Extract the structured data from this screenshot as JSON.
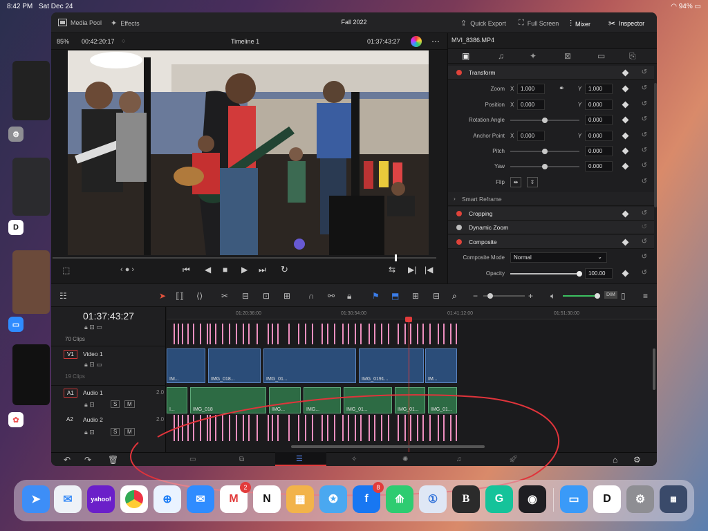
{
  "status": {
    "time": "8:42 PM",
    "date": "Sat Dec 24",
    "battery": "94%"
  },
  "topbar": {
    "media_pool": "Media Pool",
    "effects": "Effects",
    "title": "Fall 2022",
    "quick_export": "Quick Export",
    "full_screen": "Full Screen",
    "mixer": "Mixer",
    "inspector": "Inspector"
  },
  "viewer": {
    "zoom": "85%",
    "duration": "00:42:20:17",
    "timeline_name": "Timeline 1",
    "timecode": "01:37:43:27"
  },
  "inspector": {
    "clip_name": "MVI_8386.MP4",
    "sections": {
      "transform": "Transform",
      "smart_reframe": "Smart Reframe",
      "cropping": "Cropping",
      "dynamic_zoom": "Dynamic Zoom",
      "composite": "Composite"
    },
    "zoom": {
      "label": "Zoom",
      "x": "1.000",
      "y": "1.000"
    },
    "position": {
      "label": "Position",
      "x": "0.000",
      "y": "0.000"
    },
    "rotation": {
      "label": "Rotation Angle",
      "value": "0.000"
    },
    "anchor": {
      "label": "Anchor Point",
      "x": "0.000",
      "y": "0.000"
    },
    "pitch": {
      "label": "Pitch",
      "value": "0.000"
    },
    "yaw": {
      "label": "Yaw",
      "value": "0.000"
    },
    "flip": {
      "label": "Flip"
    },
    "composite_mode": {
      "label": "Composite Mode",
      "value": "Normal"
    },
    "opacity": {
      "label": "Opacity",
      "value": "100.00"
    },
    "axis_x": "X",
    "axis_y": "Y"
  },
  "timeline": {
    "timecode": "01:37:43:27",
    "ruler": [
      "01:20:36:00",
      "01:30:54:00",
      "01:41:12:00",
      "01:51:30:00"
    ],
    "track_top_clips": "70 Clips",
    "v1": {
      "id": "V1",
      "name": "Video 1",
      "clips": "19 Clips"
    },
    "a1": {
      "id": "A1",
      "name": "Audio 1",
      "level": "2.0"
    },
    "a2": {
      "id": "A2",
      "name": "Audio 2",
      "level": "2.0"
    },
    "video_clips": [
      "IM...",
      "IMG_018...",
      "IMG_01...",
      "IMG_0191...",
      "IM..."
    ],
    "audio_clips": [
      "I...",
      "IMG_018",
      "IMG...",
      "IMG...",
      "IMG_01...",
      "IMG_01...",
      "IMG_01..."
    ],
    "m_label": "M",
    "s_label": "S",
    "dim": "DIM"
  },
  "dock": {
    "gmail_badge": "2",
    "facebook_badge": "8",
    "yahoo_label": "yahoo!",
    "b_label": "B",
    "g_label": "G"
  },
  "annotation": {
    "stroke_color": "#e0343b"
  }
}
